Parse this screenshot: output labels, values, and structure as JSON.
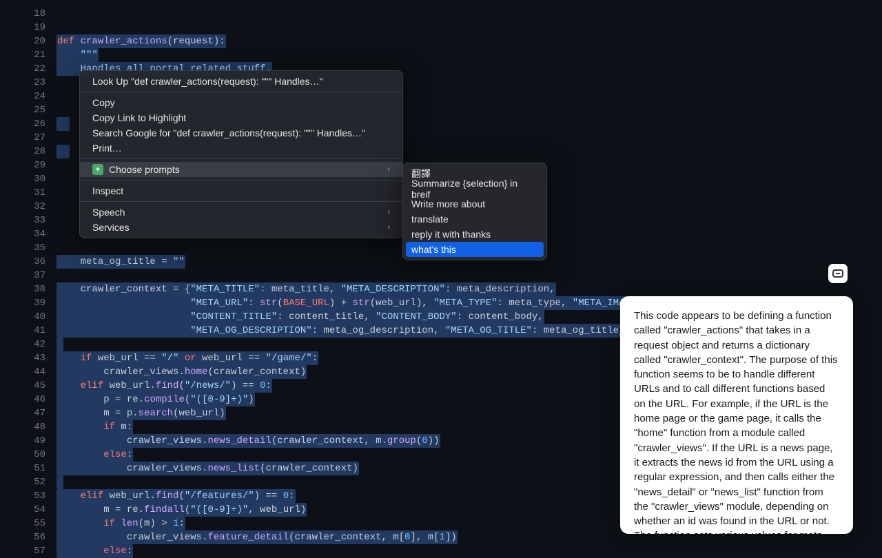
{
  "gutter": {
    "start": 18,
    "end": 57
  },
  "code_lines": [
    {
      "sel": false,
      "tokens": []
    },
    {
      "sel": false,
      "tokens": []
    },
    {
      "sel": true,
      "tokens": [
        {
          "c": "kw",
          "t": "def "
        },
        {
          "c": "fn",
          "t": "crawler_actions"
        },
        {
          "c": "op",
          "t": "(request):"
        }
      ]
    },
    {
      "sel": true,
      "indent": 1,
      "tokens": [
        {
          "c": "str",
          "t": "\"\"\""
        }
      ]
    },
    {
      "sel": true,
      "indent": 1,
      "tokens": [
        {
          "c": "str",
          "t": "Handles all portal related stuff."
        }
      ]
    },
    {
      "sel": false,
      "tokens": []
    },
    {
      "sel": false,
      "tokens": []
    },
    {
      "sel": false,
      "tokens": []
    },
    {
      "sel": true,
      "tokens": [
        {
          "c": "id",
          "t": "  "
        }
      ]
    },
    {
      "sel": false,
      "tokens": []
    },
    {
      "sel": true,
      "tokens": [
        {
          "c": "id",
          "t": "  "
        }
      ]
    },
    {
      "sel": false,
      "tokens": []
    },
    {
      "sel": false,
      "tokens": []
    },
    {
      "sel": false,
      "tokens": []
    },
    {
      "sel": false,
      "tokens": []
    },
    {
      "sel": false,
      "tokens": []
    },
    {
      "sel": false,
      "tokens": []
    },
    {
      "sel": false,
      "tokens": []
    },
    {
      "sel": true,
      "indent": 1,
      "tokens": [
        {
          "c": "id",
          "t": "meta_og_title "
        },
        {
          "c": "op",
          "t": "= "
        },
        {
          "c": "str",
          "t": "\"\""
        }
      ]
    },
    {
      "sel": false,
      "tokens": []
    },
    {
      "sel": true,
      "indent": 1,
      "tokens": [
        {
          "c": "id",
          "t": "crawler_context "
        },
        {
          "c": "op",
          "t": "= {"
        },
        {
          "c": "str",
          "t": "\"META_TITLE\""
        },
        {
          "c": "op",
          "t": ": meta_title, "
        },
        {
          "c": "str",
          "t": "\"META_DESCRIPTION\""
        },
        {
          "c": "op",
          "t": ": meta_description,"
        }
      ]
    },
    {
      "sel": true,
      "indent": 0,
      "tokens": [
        {
          "c": "op",
          "t": "                       "
        },
        {
          "c": "str",
          "t": "\"META_URL\""
        },
        {
          "c": "op",
          "t": ": "
        },
        {
          "c": "fn",
          "t": "str"
        },
        {
          "c": "op",
          "t": "("
        },
        {
          "c": "const",
          "t": "BASE_URL"
        },
        {
          "c": "op",
          "t": ") + "
        },
        {
          "c": "fn",
          "t": "str"
        },
        {
          "c": "op",
          "t": "(web_url), "
        },
        {
          "c": "str",
          "t": "\"META_TYPE\""
        },
        {
          "c": "op",
          "t": ": meta_type, "
        },
        {
          "c": "str",
          "t": "\"META_IMAGE\""
        },
        {
          "c": "op",
          "t": ": meta_ima"
        }
      ]
    },
    {
      "sel": true,
      "indent": 0,
      "tokens": [
        {
          "c": "op",
          "t": "                       "
        },
        {
          "c": "str",
          "t": "\"CONTENT_TITLE\""
        },
        {
          "c": "op",
          "t": ": content_title, "
        },
        {
          "c": "str",
          "t": "\"CONTENT_BODY\""
        },
        {
          "c": "op",
          "t": ": content_body,"
        }
      ]
    },
    {
      "sel": true,
      "indent": 0,
      "tokens": [
        {
          "c": "op",
          "t": "                       "
        },
        {
          "c": "str",
          "t": "\"META_OG_DESCRIPTION\""
        },
        {
          "c": "op",
          "t": ": meta_og_description, "
        },
        {
          "c": "str",
          "t": "\"META_OG_TITLE\""
        },
        {
          "c": "op",
          "t": ": meta_og_title}"
        }
      ]
    },
    {
      "sel": true,
      "tokens": []
    },
    {
      "sel": true,
      "indent": 1,
      "tokens": [
        {
          "c": "kw",
          "t": "if"
        },
        {
          "c": "id",
          "t": " web_url "
        },
        {
          "c": "op",
          "t": "== "
        },
        {
          "c": "str",
          "t": "\"/\""
        },
        {
          "c": "kw",
          "t": " or "
        },
        {
          "c": "id",
          "t": "web_url "
        },
        {
          "c": "op",
          "t": "== "
        },
        {
          "c": "str",
          "t": "\"/game/\""
        },
        {
          "c": "op",
          "t": ":"
        }
      ]
    },
    {
      "sel": true,
      "indent": 2,
      "tokens": [
        {
          "c": "id",
          "t": "crawler_views."
        },
        {
          "c": "fn",
          "t": "home"
        },
        {
          "c": "op",
          "t": "(crawler_context)"
        }
      ]
    },
    {
      "sel": true,
      "indent": 1,
      "tokens": [
        {
          "c": "kw",
          "t": "elif"
        },
        {
          "c": "id",
          "t": " web_url."
        },
        {
          "c": "fn",
          "t": "find"
        },
        {
          "c": "op",
          "t": "("
        },
        {
          "c": "str",
          "t": "\"/news/\""
        },
        {
          "c": "op",
          "t": ") == "
        },
        {
          "c": "num",
          "t": "0"
        },
        {
          "c": "op",
          "t": ":"
        }
      ]
    },
    {
      "sel": true,
      "indent": 2,
      "tokens": [
        {
          "c": "id",
          "t": "p "
        },
        {
          "c": "op",
          "t": "= re."
        },
        {
          "c": "fn",
          "t": "compile"
        },
        {
          "c": "op",
          "t": "("
        },
        {
          "c": "str",
          "t": "\"([0-9]+)\""
        },
        {
          "c": "op",
          "t": ")"
        }
      ]
    },
    {
      "sel": true,
      "indent": 2,
      "tokens": [
        {
          "c": "id",
          "t": "m "
        },
        {
          "c": "op",
          "t": "= p."
        },
        {
          "c": "fn",
          "t": "search"
        },
        {
          "c": "op",
          "t": "(web_url)"
        }
      ]
    },
    {
      "sel": true,
      "indent": 2,
      "tokens": [
        {
          "c": "kw",
          "t": "if"
        },
        {
          "c": "id",
          "t": " m"
        },
        {
          "c": "op",
          "t": ":"
        }
      ]
    },
    {
      "sel": true,
      "indent": 3,
      "tokens": [
        {
          "c": "id",
          "t": "crawler_views."
        },
        {
          "c": "fn",
          "t": "news_detail"
        },
        {
          "c": "op",
          "t": "(crawler_context, m."
        },
        {
          "c": "fn",
          "t": "group"
        },
        {
          "c": "op",
          "t": "("
        },
        {
          "c": "num",
          "t": "0"
        },
        {
          "c": "op",
          "t": "))"
        }
      ]
    },
    {
      "sel": true,
      "indent": 2,
      "tokens": [
        {
          "c": "kw",
          "t": "else"
        },
        {
          "c": "op",
          "t": ":"
        }
      ]
    },
    {
      "sel": true,
      "indent": 3,
      "tokens": [
        {
          "c": "id",
          "t": "crawler_views."
        },
        {
          "c": "fn",
          "t": "news_list"
        },
        {
          "c": "op",
          "t": "(crawler_context)"
        }
      ]
    },
    {
      "sel": true,
      "tokens": []
    },
    {
      "sel": true,
      "indent": 1,
      "tokens": [
        {
          "c": "kw",
          "t": "elif"
        },
        {
          "c": "id",
          "t": " web_url."
        },
        {
          "c": "fn",
          "t": "find"
        },
        {
          "c": "op",
          "t": "("
        },
        {
          "c": "str",
          "t": "\"/features/\""
        },
        {
          "c": "op",
          "t": ") == "
        },
        {
          "c": "num",
          "t": "0"
        },
        {
          "c": "op",
          "t": ":"
        }
      ]
    },
    {
      "sel": true,
      "indent": 2,
      "tokens": [
        {
          "c": "id",
          "t": "m "
        },
        {
          "c": "op",
          "t": "= re."
        },
        {
          "c": "fn",
          "t": "findall"
        },
        {
          "c": "op",
          "t": "("
        },
        {
          "c": "str",
          "t": "\"([0-9]+)\""
        },
        {
          "c": "op",
          "t": ", web_url)"
        }
      ]
    },
    {
      "sel": true,
      "indent": 2,
      "tokens": [
        {
          "c": "kw",
          "t": "if"
        },
        {
          "c": "id",
          "t": " "
        },
        {
          "c": "fn",
          "t": "len"
        },
        {
          "c": "op",
          "t": "(m) > "
        },
        {
          "c": "num",
          "t": "1"
        },
        {
          "c": "op",
          "t": ":"
        }
      ]
    },
    {
      "sel": true,
      "indent": 3,
      "tokens": [
        {
          "c": "id",
          "t": "crawler_views."
        },
        {
          "c": "fn",
          "t": "feature_detail"
        },
        {
          "c": "op",
          "t": "(crawler_context, m["
        },
        {
          "c": "num",
          "t": "0"
        },
        {
          "c": "op",
          "t": "], m["
        },
        {
          "c": "num",
          "t": "1"
        },
        {
          "c": "op",
          "t": "])"
        }
      ]
    },
    {
      "sel": true,
      "indent": 2,
      "tokens": [
        {
          "c": "kw",
          "t": "else"
        },
        {
          "c": "op",
          "t": ":"
        }
      ]
    }
  ],
  "context_menu": {
    "items": [
      {
        "label": "Look Up \"def crawler_actions(request):    \"\"\"    Handles…\"",
        "sub": false
      },
      {
        "sep": true
      },
      {
        "label": "Copy",
        "sub": false
      },
      {
        "label": "Copy Link to Highlight",
        "sub": false
      },
      {
        "label": "Search Google for \"def crawler_actions(request):    \"\"\"    Handles…\"",
        "sub": false
      },
      {
        "label": "Print…",
        "sub": false
      },
      {
        "sep": true
      },
      {
        "label": "Choose prompts",
        "sub": true,
        "icon": true,
        "hov": true
      },
      {
        "sep": true
      },
      {
        "label": "Inspect",
        "sub": false
      },
      {
        "sep": true
      },
      {
        "label": "Speech",
        "sub": true
      },
      {
        "label": "Services",
        "sub": true
      }
    ]
  },
  "submenu": {
    "items": [
      {
        "label": "翻譯"
      },
      {
        "label": "Summarize {selection} in breif"
      },
      {
        "label": "Write more about"
      },
      {
        "label": "translate"
      },
      {
        "label": "reply it with thanks"
      },
      {
        "label": "what's this",
        "hl": true
      }
    ]
  },
  "tooltip": {
    "text": "This code appears to be defining a function called \"crawler_actions\" that takes in a request object and returns a dictionary called \"crawler_context\". The purpose of this function seems to be to handle different URLs and to call different functions based on the URL. For example, if the URL is the home page or the game page, it calls the \"home\" function from a module called \"crawler_views\". If the URL is a news page, it extracts the news id from the URL using a regular expression, and then calls either the \"news_detail\" or \"news_list\" function from the \"crawler_views\" module, depending on whether an id was found in the URL or not. The function sets various values for meta"
  }
}
